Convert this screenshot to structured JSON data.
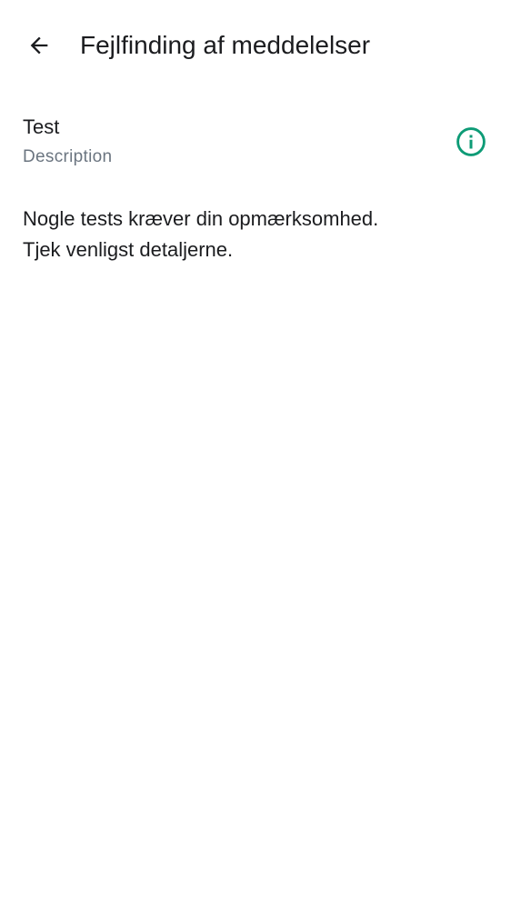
{
  "header": {
    "title": "Fejlfinding af meddelelser",
    "back_icon": "arrow-back-icon"
  },
  "test_item": {
    "title": "Test",
    "description": "Description",
    "info_icon": "info-circle-icon",
    "accent_color": "#0d9b76"
  },
  "message": {
    "line1": "Nogle tests kræver din opmærksomhed.",
    "line2": "Tjek venligst detaljerne."
  }
}
